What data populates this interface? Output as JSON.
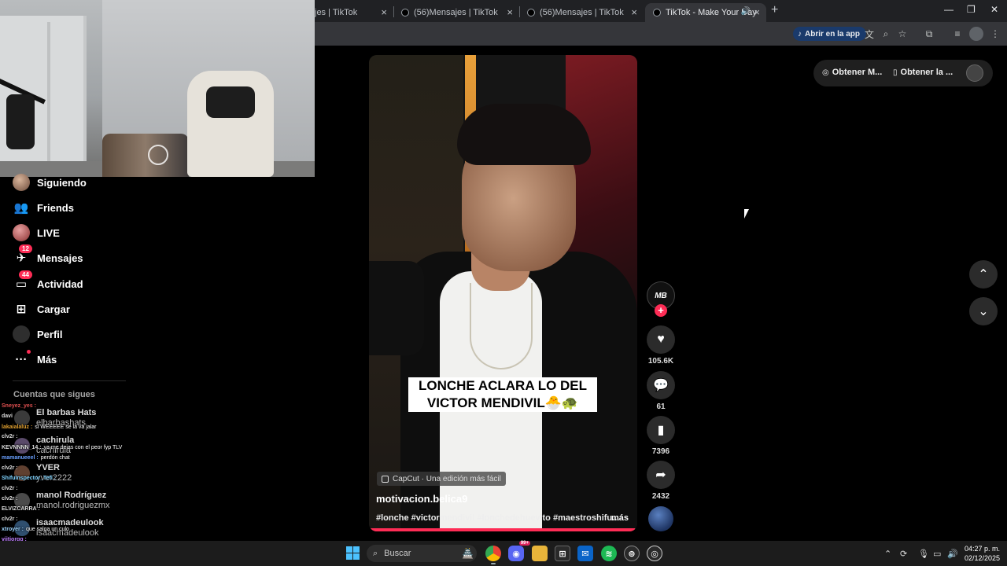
{
  "browser": {
    "tabs": [
      {
        "title": "jes | TikTok",
        "active": false
      },
      {
        "title": "(56)Mensajes | TikTok",
        "active": false
      },
      {
        "title": "(56)Mensajes | TikTok",
        "active": false
      },
      {
        "title": "TikTok - Make Your Day",
        "active": true
      }
    ],
    "tab_close": "×",
    "new_tab": "+",
    "open_in_app": "Abrir en la app"
  },
  "sidebar": {
    "items": [
      {
        "label": "Siguiendo",
        "icon": "following-avatar"
      },
      {
        "label": "Friends",
        "icon": "friends-icon"
      },
      {
        "label": "LIVE",
        "icon": "live-avatar"
      },
      {
        "label": "Mensajes",
        "icon": "messages-icon",
        "badge": "12"
      },
      {
        "label": "Actividad",
        "icon": "activity-icon",
        "badge": "44"
      },
      {
        "label": "Cargar",
        "icon": "upload-icon"
      },
      {
        "label": "Perfil",
        "icon": "profile-avatar"
      },
      {
        "label": "Más",
        "icon": "more-icon"
      }
    ],
    "following_header": "Cuentas que sigues",
    "following": [
      {
        "name": "El barbas Hats",
        "handle": "elbarbashats"
      },
      {
        "name": "cachirula",
        "handle": "cachirula"
      },
      {
        "name": "YVER",
        "handle": "yver2222"
      },
      {
        "name": "manol Rodríguez",
        "handle": "manol.rodriguezmx"
      },
      {
        "name": "isaacmadeulook",
        "handle": "isaacmadeulook"
      }
    ]
  },
  "chat": [
    {
      "user": "Sneyez_yes :",
      "text": "",
      "color": "#e05050"
    },
    {
      "user": "davi",
      "text": "",
      "color": "#ddd"
    },
    {
      "user": "lakaialaluz :",
      "text": "si WEEEEE se la va jalar",
      "color": "#e0a030"
    },
    {
      "user": "clv2r :",
      "text": "",
      "color": "#ddd"
    },
    {
      "user": "KEVNNNN_14 :",
      "text": "ya me dejas con el peor fyp TLV",
      "color": "#ddd"
    },
    {
      "user": "mamanueeel :",
      "text": "perdón chat",
      "color": "#6aa0ff"
    },
    {
      "user": "clv2r :",
      "text": "",
      "color": "#ddd"
    },
    {
      "user": "ShifuInspector_Tefi :",
      "text": "",
      "color": "#7fd3ff"
    },
    {
      "user": "clv2r :",
      "text": "",
      "color": "#ddd"
    },
    {
      "user": "clv2r :",
      "text": "",
      "color": "#ddd"
    },
    {
      "user": "ELVIZCARRA :",
      "text": "",
      "color": "#ddd"
    },
    {
      "user": "clv2r :",
      "text": "",
      "color": "#ddd"
    },
    {
      "user": "xtroyer :",
      "text": "que salga un culo",
      "color": "#9fd6ff"
    },
    {
      "user": "viitiorgg :",
      "text": "",
      "color": "#c080ff"
    },
    {
      "user": "clv2r :",
      "text": "",
      "color": "#ddd"
    },
    {
      "user": "clv2r :",
      "text": "",
      "color": "#ddd"
    }
  ],
  "video": {
    "caption": "LONCHE ACLARA LO DEL VICTOR MENDIVIL🐣🐢",
    "capcut": "CapCut · Una edición más fácil",
    "username": "motivacion.belica9",
    "description": "#lonche #victormendivil #lonchedehuevito #maestroshifu...",
    "more": "más",
    "progress": 0.99
  },
  "actions": {
    "author_initials": "MB",
    "likes": "105.6K",
    "comments": "61",
    "saves": "7396",
    "shares": "2432"
  },
  "get_buttons": {
    "coins": "Obtener M...",
    "app": "Obtener la ..."
  },
  "taskbar": {
    "search_placeholder": "Buscar",
    "time": "04:27 p. m.",
    "date": "02/12/2025",
    "notif_badge": "99+"
  },
  "colors": {
    "accent": "#fe2c55",
    "page_bg": "#000000"
  }
}
